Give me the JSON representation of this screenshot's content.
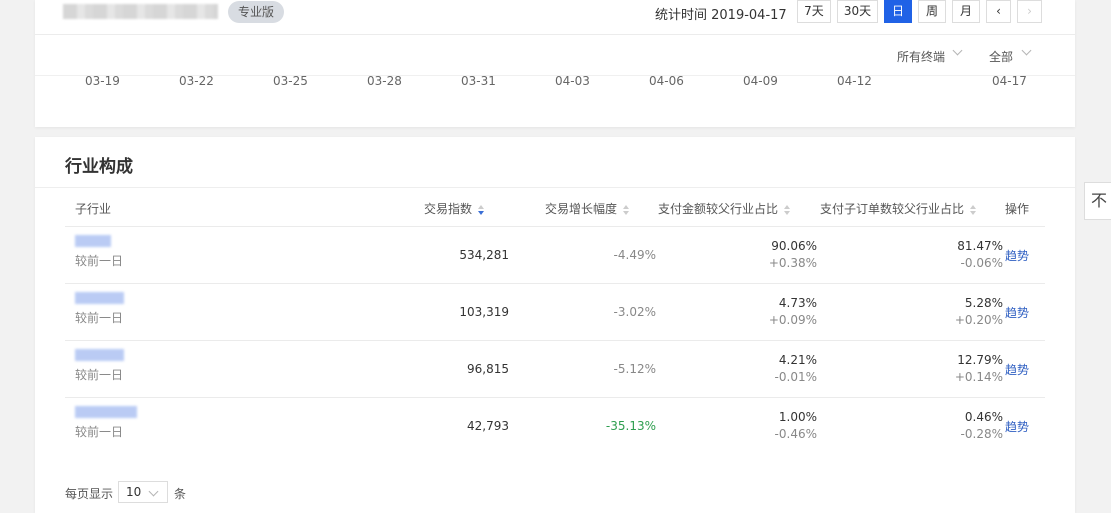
{
  "header": {
    "badge": "专业版",
    "stat_time": "统计时间 2019-04-17",
    "ranges": [
      "7天",
      "30天",
      "日",
      "周",
      "月"
    ],
    "active_range": "日",
    "terminal_filter": "所有终端",
    "scope_filter": "全部"
  },
  "timeline": {
    "dates": [
      "03-19",
      "03-22",
      "03-25",
      "03-28",
      "03-31",
      "04-03",
      "04-06",
      "04-09",
      "04-12",
      "04-17"
    ]
  },
  "industry": {
    "title": "行业构成",
    "columns": {
      "sub_industry": "子行业",
      "trade_index": "交易指数",
      "trade_growth": "交易增长幅度",
      "pay_amount_share": "支付金额较父行业占比",
      "pay_orders_share": "支付子订单数较父行业占比",
      "action": "操作"
    },
    "rows": [
      {
        "compare": "较前一日",
        "index": "534,281",
        "growth": "-4.49%",
        "amount_share": "90.06%",
        "amount_change": "+0.38%",
        "orders_share": "81.47%",
        "orders_change": "-0.06%",
        "action": "趋势"
      },
      {
        "compare": "较前一日",
        "index": "103,319",
        "growth": "-3.02%",
        "amount_share": "4.73%",
        "amount_change": "+0.09%",
        "orders_share": "5.28%",
        "orders_change": "+0.20%",
        "action": "趋势"
      },
      {
        "compare": "较前一日",
        "index": "96,815",
        "growth": "-5.12%",
        "amount_share": "4.21%",
        "amount_change": "-0.01%",
        "orders_share": "12.79%",
        "orders_change": "+0.14%",
        "action": "趋势"
      },
      {
        "compare": "较前一日",
        "index": "42,793",
        "growth": "-35.13%",
        "amount_share": "1.00%",
        "amount_change": "-0.46%",
        "orders_share": "0.46%",
        "orders_change": "-0.28%",
        "action": "趋势"
      }
    ],
    "pager": {
      "prefix": "每页显示",
      "page_size": "10",
      "suffix": "条"
    }
  },
  "floating_button": "不",
  "colors": {
    "accent": "#2062e6",
    "link": "#2f5fc2",
    "growth_highlight": "#2e9e4f"
  }
}
